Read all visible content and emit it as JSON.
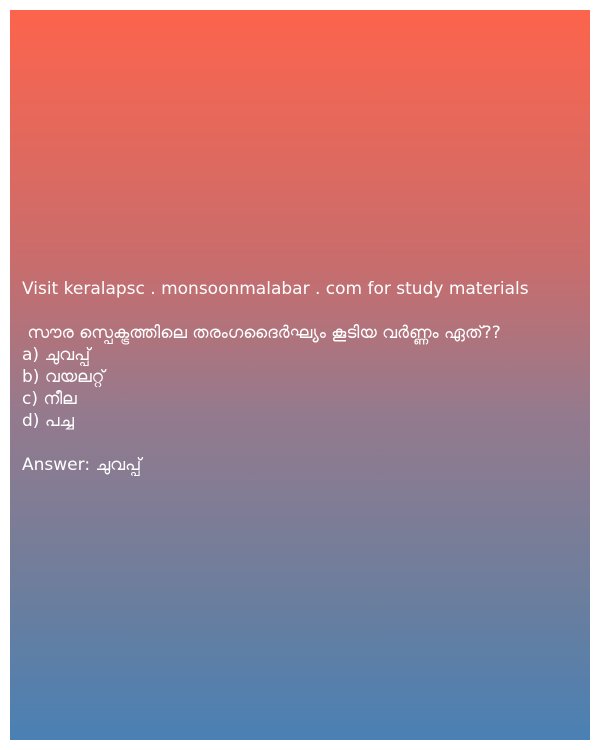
{
  "visit_text": "Visit keralapsc . monsoonmalabar . com for study materials",
  "question": " സൗര സ്പെക്ട്രത്തിലെ തരംഗദൈർഘ്യം കൂടിയ വർണ്ണം ഏത്??",
  "options": [
    "a) ചുവപ്പ്",
    "b) വയലറ്റ്",
    "c) നീല",
    "d) പച്ച"
  ],
  "answer": "Answer: ചുവപ്പ്",
  "colors": {
    "gradient_top": "#fd644c",
    "gradient_bottom": "#4a80b4",
    "text": "#ffffff"
  }
}
